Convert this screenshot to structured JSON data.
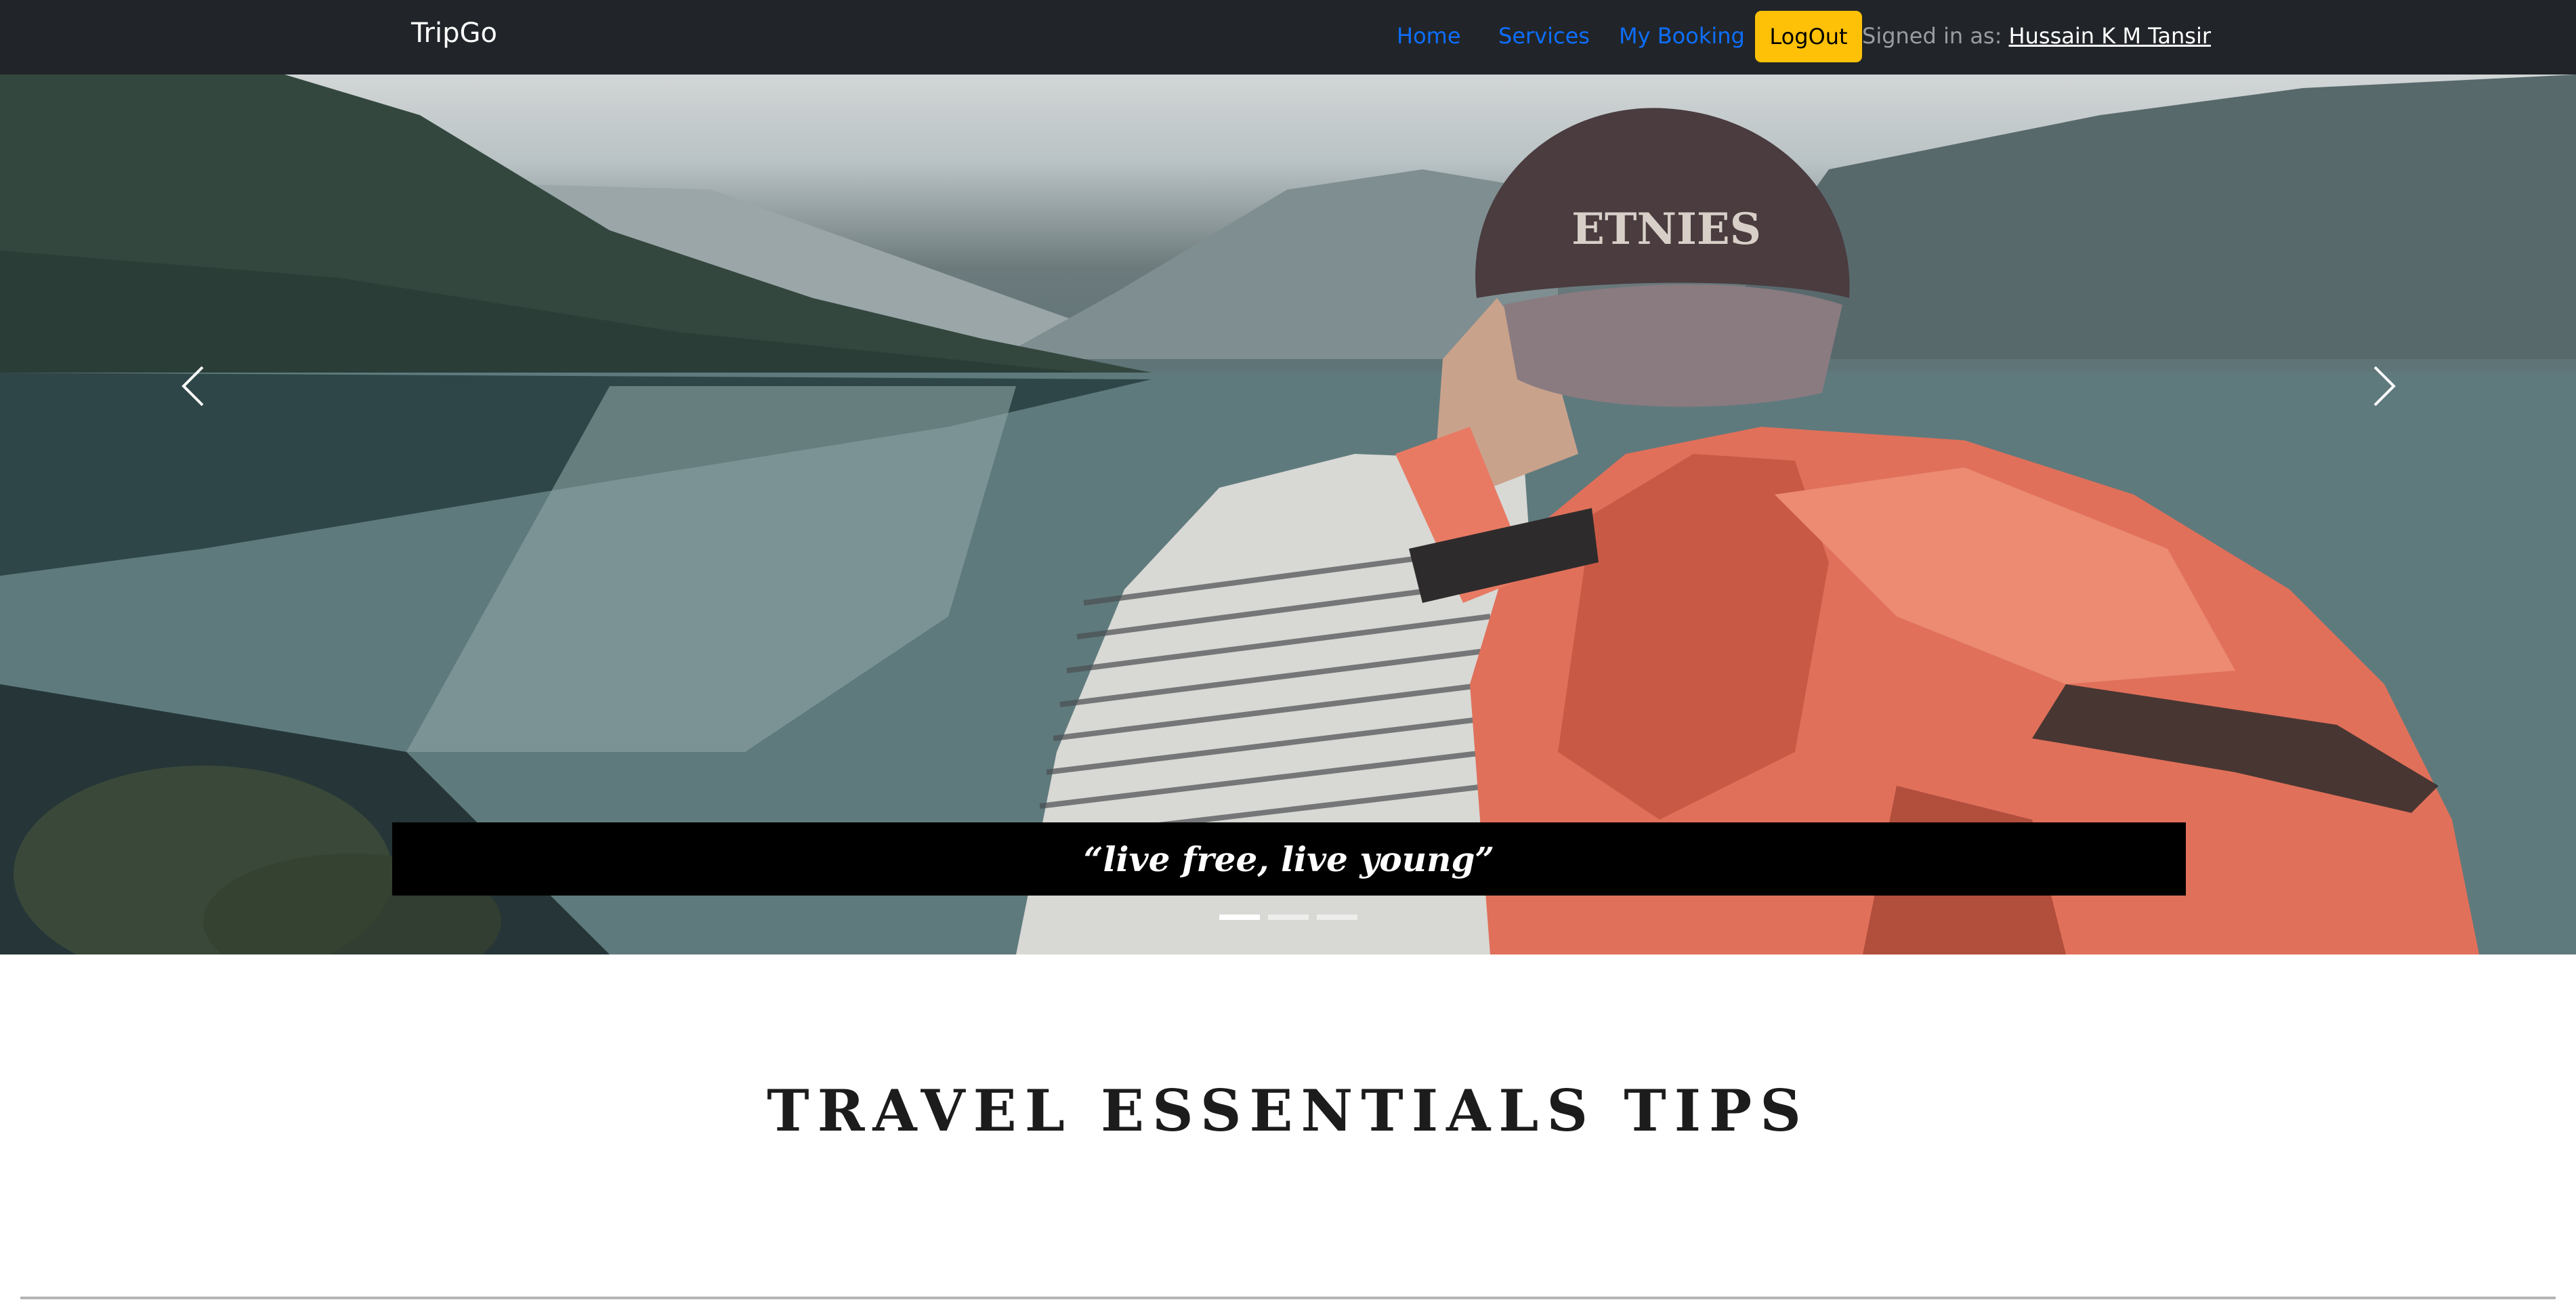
{
  "navbar": {
    "brand": "TripGo",
    "links": [
      "Home",
      "Services",
      "My Booking"
    ],
    "logout_label": "LogOut",
    "signed_in_label": "Signed in as:",
    "user_name": "Hussain K M Tansir",
    "colors": {
      "background": "#212529",
      "link": "#0d6efd",
      "logout": "#ffc107"
    }
  },
  "hero": {
    "caption": "“live free, live young”",
    "prev_icon": "chevron-left-icon",
    "next_icon": "chevron-right-icon",
    "slide_count": 3,
    "active_slide": 1
  },
  "section": {
    "title": "TRAVEL ESSENTIALS TIPS"
  }
}
